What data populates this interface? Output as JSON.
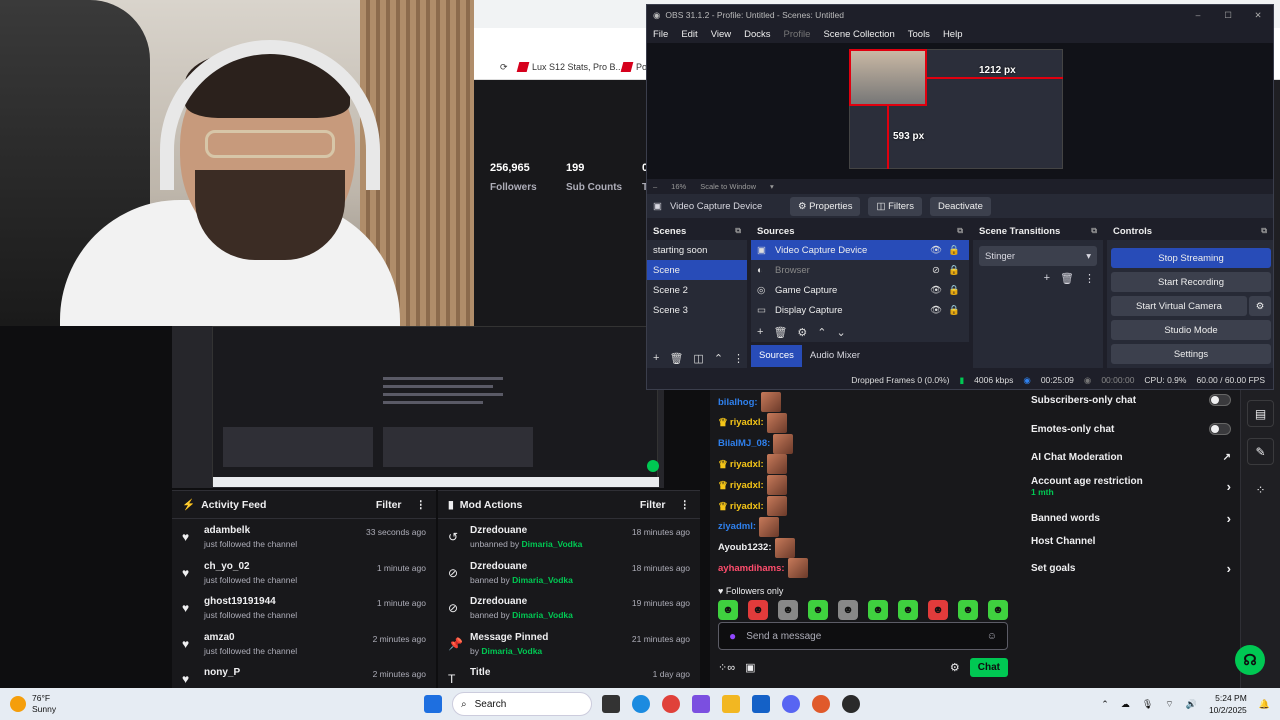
{
  "browser": {
    "bookmarks": [
      {
        "label": "Lux S12 Stats, Pro B..."
      },
      {
        "label": "Por"
      }
    ],
    "stats": [
      {
        "value": "256,965",
        "label": "Followers"
      },
      {
        "value": "199",
        "label": "Sub Counts"
      },
      {
        "value": "0",
        "label": "T"
      }
    ]
  },
  "activity_feed": {
    "title": "Activity Feed",
    "filter": "Filter",
    "items": [
      {
        "name": "adambelk",
        "sub": "just followed the channel",
        "time": "33 seconds ago"
      },
      {
        "name": "ch_yo_02",
        "sub": "just followed the channel",
        "time": "1 minute ago"
      },
      {
        "name": "ghost19191944",
        "sub": "just followed the channel",
        "time": "1 minute ago"
      },
      {
        "name": "amza0",
        "sub": "just followed the channel",
        "time": "2 minutes ago"
      },
      {
        "name": "nony_P",
        "sub": "",
        "time": "2 minutes ago"
      }
    ]
  },
  "mod_actions": {
    "title": "Mod Actions",
    "filter": "Filter",
    "items": [
      {
        "name": "Dzredouane",
        "prefix": "unbanned by",
        "by": "Dimaria_Vodka",
        "time": "18 minutes ago",
        "icon": "↺"
      },
      {
        "name": "Dzredouane",
        "prefix": "banned by",
        "by": "Dimaria_Vodka",
        "time": "18 minutes ago",
        "icon": "⊘"
      },
      {
        "name": "Dzredouane",
        "prefix": "banned by",
        "by": "Dimaria_Vodka",
        "time": "19 minutes ago",
        "icon": "⊘"
      },
      {
        "name": "Message Pinned",
        "prefix": "by",
        "by": "Dimaria_Vodka",
        "time": "21 minutes ago",
        "icon": "📌"
      },
      {
        "name": "Title",
        "prefix": "",
        "by": "",
        "time": "1 day ago",
        "icon": "T"
      }
    ]
  },
  "chat": {
    "lines": [
      {
        "user": "bilalhog:",
        "color": "#2f80ed",
        "crown": false
      },
      {
        "user": "riyadxl:",
        "color": "#f5c518",
        "crown": true
      },
      {
        "user": "BilalMJ_08:",
        "color": "#2f80ed",
        "crown": false
      },
      {
        "user": "riyadxl:",
        "color": "#f5c518",
        "crown": true
      },
      {
        "user": "riyadxl:",
        "color": "#f5c518",
        "crown": true
      },
      {
        "user": "riyadxl:",
        "color": "#f5c518",
        "crown": true
      },
      {
        "user": "ziyadml:",
        "color": "#2f80ed",
        "crown": false
      },
      {
        "user": "Ayoub1232:",
        "color": "#efeff1",
        "crown": false
      },
      {
        "user": "ayhamdihams:",
        "color": "#ff4d6d",
        "crown": false
      }
    ],
    "followers_only": "Followers only",
    "placeholder": "Send a message",
    "chat_button": "Chat"
  },
  "mod_settings": {
    "items": [
      {
        "label": "Subscribers-only chat",
        "control": "toggle"
      },
      {
        "label": "Emotes-only chat",
        "control": "toggle"
      },
      {
        "label": "AI Chat Moderation",
        "control": "external"
      },
      {
        "label": "Account age restriction",
        "sub": "1 mth",
        "control": "chevron"
      },
      {
        "label": "Banned words",
        "control": "chevron"
      },
      {
        "label": "Host Channel",
        "control": "none"
      },
      {
        "label": "Set goals",
        "control": "chevron"
      }
    ]
  },
  "obs": {
    "title": "OBS 31.1.2 - Profile: Untitled - Scenes: Untitled",
    "menu": [
      "File",
      "Edit",
      "View",
      "Docks",
      "Profile",
      "Scene Collection",
      "Tools",
      "Help"
    ],
    "preview_width_label": "1212 px",
    "preview_height_label": "593 px",
    "zoom": "16%",
    "scale_mode": "Scale to Window",
    "selected_source": "Video Capture Device",
    "source_buttons": {
      "properties": "Properties",
      "filters": "Filters",
      "deactivate": "Deactivate"
    },
    "scenes": {
      "title": "Scenes",
      "items": [
        "starting soon",
        "Scene",
        "Scene 2",
        "Scene 3"
      ],
      "selected": 1
    },
    "sources": {
      "title": "Sources",
      "items": [
        {
          "name": "Video Capture Device",
          "icon": "▣",
          "visible": true,
          "selected": true
        },
        {
          "name": "Browser",
          "icon": "◐",
          "visible": false,
          "selected": false
        },
        {
          "name": "Game Capture",
          "icon": "◎",
          "visible": true,
          "selected": false
        },
        {
          "name": "Display Capture",
          "icon": "▭",
          "visible": true,
          "selected": false
        }
      ]
    },
    "transitions": {
      "title": "Scene Transitions",
      "value": "Stinger"
    },
    "controls": {
      "title": "Controls",
      "buttons": [
        "Stop Streaming",
        "Start Recording",
        "Start Virtual Camera",
        "Studio Mode",
        "Settings"
      ]
    },
    "tabs": [
      "Sources",
      "Audio Mixer"
    ],
    "status": {
      "dropped": "Dropped Frames 0 (0.0%)",
      "bitrate": "4006 kbps",
      "live_time": "00:25:09",
      "rec_time": "00:00:00",
      "cpu": "CPU: 0.9%",
      "fps": "60.00 / 60.00 FPS"
    }
  },
  "taskbar": {
    "weather_temp": "76°F",
    "weather_desc": "Sunny",
    "search": "Search",
    "time": "5:24 PM",
    "date": "10/2/2025"
  },
  "colors": {
    "accent_green": "#00c853",
    "obs_blue": "#284cb8",
    "twitch_purple": "#9147ff"
  }
}
